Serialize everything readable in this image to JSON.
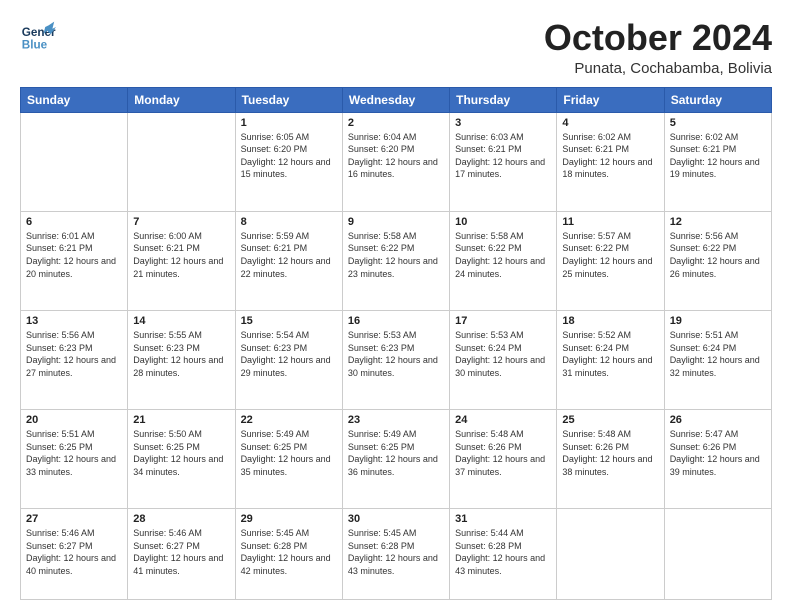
{
  "header": {
    "logo_general": "General",
    "logo_blue": "Blue",
    "month_year": "October 2024",
    "location": "Punata, Cochabamba, Bolivia"
  },
  "weekdays": [
    "Sunday",
    "Monday",
    "Tuesday",
    "Wednesday",
    "Thursday",
    "Friday",
    "Saturday"
  ],
  "weeks": [
    [
      {
        "day": "",
        "sunrise": "",
        "sunset": "",
        "daylight": ""
      },
      {
        "day": "",
        "sunrise": "",
        "sunset": "",
        "daylight": ""
      },
      {
        "day": "1",
        "sunrise": "Sunrise: 6:05 AM",
        "sunset": "Sunset: 6:20 PM",
        "daylight": "Daylight: 12 hours and 15 minutes."
      },
      {
        "day": "2",
        "sunrise": "Sunrise: 6:04 AM",
        "sunset": "Sunset: 6:20 PM",
        "daylight": "Daylight: 12 hours and 16 minutes."
      },
      {
        "day": "3",
        "sunrise": "Sunrise: 6:03 AM",
        "sunset": "Sunset: 6:21 PM",
        "daylight": "Daylight: 12 hours and 17 minutes."
      },
      {
        "day": "4",
        "sunrise": "Sunrise: 6:02 AM",
        "sunset": "Sunset: 6:21 PM",
        "daylight": "Daylight: 12 hours and 18 minutes."
      },
      {
        "day": "5",
        "sunrise": "Sunrise: 6:02 AM",
        "sunset": "Sunset: 6:21 PM",
        "daylight": "Daylight: 12 hours and 19 minutes."
      }
    ],
    [
      {
        "day": "6",
        "sunrise": "Sunrise: 6:01 AM",
        "sunset": "Sunset: 6:21 PM",
        "daylight": "Daylight: 12 hours and 20 minutes."
      },
      {
        "day": "7",
        "sunrise": "Sunrise: 6:00 AM",
        "sunset": "Sunset: 6:21 PM",
        "daylight": "Daylight: 12 hours and 21 minutes."
      },
      {
        "day": "8",
        "sunrise": "Sunrise: 5:59 AM",
        "sunset": "Sunset: 6:21 PM",
        "daylight": "Daylight: 12 hours and 22 minutes."
      },
      {
        "day": "9",
        "sunrise": "Sunrise: 5:58 AM",
        "sunset": "Sunset: 6:22 PM",
        "daylight": "Daylight: 12 hours and 23 minutes."
      },
      {
        "day": "10",
        "sunrise": "Sunrise: 5:58 AM",
        "sunset": "Sunset: 6:22 PM",
        "daylight": "Daylight: 12 hours and 24 minutes."
      },
      {
        "day": "11",
        "sunrise": "Sunrise: 5:57 AM",
        "sunset": "Sunset: 6:22 PM",
        "daylight": "Daylight: 12 hours and 25 minutes."
      },
      {
        "day": "12",
        "sunrise": "Sunrise: 5:56 AM",
        "sunset": "Sunset: 6:22 PM",
        "daylight": "Daylight: 12 hours and 26 minutes."
      }
    ],
    [
      {
        "day": "13",
        "sunrise": "Sunrise: 5:56 AM",
        "sunset": "Sunset: 6:23 PM",
        "daylight": "Daylight: 12 hours and 27 minutes."
      },
      {
        "day": "14",
        "sunrise": "Sunrise: 5:55 AM",
        "sunset": "Sunset: 6:23 PM",
        "daylight": "Daylight: 12 hours and 28 minutes."
      },
      {
        "day": "15",
        "sunrise": "Sunrise: 5:54 AM",
        "sunset": "Sunset: 6:23 PM",
        "daylight": "Daylight: 12 hours and 29 minutes."
      },
      {
        "day": "16",
        "sunrise": "Sunrise: 5:53 AM",
        "sunset": "Sunset: 6:23 PM",
        "daylight": "Daylight: 12 hours and 30 minutes."
      },
      {
        "day": "17",
        "sunrise": "Sunrise: 5:53 AM",
        "sunset": "Sunset: 6:24 PM",
        "daylight": "Daylight: 12 hours and 30 minutes."
      },
      {
        "day": "18",
        "sunrise": "Sunrise: 5:52 AM",
        "sunset": "Sunset: 6:24 PM",
        "daylight": "Daylight: 12 hours and 31 minutes."
      },
      {
        "day": "19",
        "sunrise": "Sunrise: 5:51 AM",
        "sunset": "Sunset: 6:24 PM",
        "daylight": "Daylight: 12 hours and 32 minutes."
      }
    ],
    [
      {
        "day": "20",
        "sunrise": "Sunrise: 5:51 AM",
        "sunset": "Sunset: 6:25 PM",
        "daylight": "Daylight: 12 hours and 33 minutes."
      },
      {
        "day": "21",
        "sunrise": "Sunrise: 5:50 AM",
        "sunset": "Sunset: 6:25 PM",
        "daylight": "Daylight: 12 hours and 34 minutes."
      },
      {
        "day": "22",
        "sunrise": "Sunrise: 5:49 AM",
        "sunset": "Sunset: 6:25 PM",
        "daylight": "Daylight: 12 hours and 35 minutes."
      },
      {
        "day": "23",
        "sunrise": "Sunrise: 5:49 AM",
        "sunset": "Sunset: 6:25 PM",
        "daylight": "Daylight: 12 hours and 36 minutes."
      },
      {
        "day": "24",
        "sunrise": "Sunrise: 5:48 AM",
        "sunset": "Sunset: 6:26 PM",
        "daylight": "Daylight: 12 hours and 37 minutes."
      },
      {
        "day": "25",
        "sunrise": "Sunrise: 5:48 AM",
        "sunset": "Sunset: 6:26 PM",
        "daylight": "Daylight: 12 hours and 38 minutes."
      },
      {
        "day": "26",
        "sunrise": "Sunrise: 5:47 AM",
        "sunset": "Sunset: 6:26 PM",
        "daylight": "Daylight: 12 hours and 39 minutes."
      }
    ],
    [
      {
        "day": "27",
        "sunrise": "Sunrise: 5:46 AM",
        "sunset": "Sunset: 6:27 PM",
        "daylight": "Daylight: 12 hours and 40 minutes."
      },
      {
        "day": "28",
        "sunrise": "Sunrise: 5:46 AM",
        "sunset": "Sunset: 6:27 PM",
        "daylight": "Daylight: 12 hours and 41 minutes."
      },
      {
        "day": "29",
        "sunrise": "Sunrise: 5:45 AM",
        "sunset": "Sunset: 6:28 PM",
        "daylight": "Daylight: 12 hours and 42 minutes."
      },
      {
        "day": "30",
        "sunrise": "Sunrise: 5:45 AM",
        "sunset": "Sunset: 6:28 PM",
        "daylight": "Daylight: 12 hours and 43 minutes."
      },
      {
        "day": "31",
        "sunrise": "Sunrise: 5:44 AM",
        "sunset": "Sunset: 6:28 PM",
        "daylight": "Daylight: 12 hours and 43 minutes."
      },
      {
        "day": "",
        "sunrise": "",
        "sunset": "",
        "daylight": ""
      },
      {
        "day": "",
        "sunrise": "",
        "sunset": "",
        "daylight": ""
      }
    ]
  ]
}
